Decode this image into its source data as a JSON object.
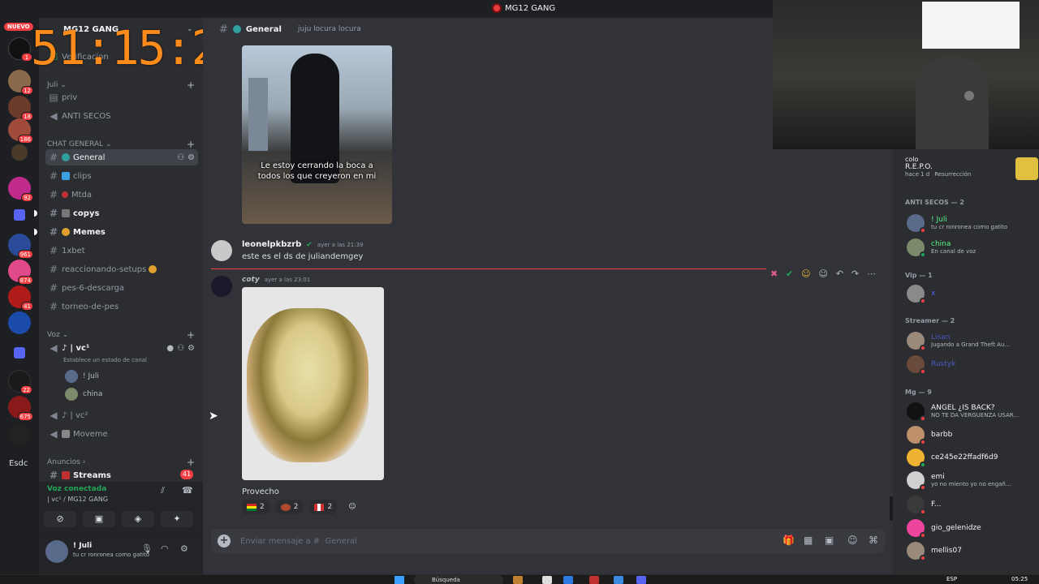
{
  "window": {
    "title": "MG12 GANG"
  },
  "rail": {
    "nuevo_label": "NUEVO",
    "badges": [
      "1",
      "12",
      "18",
      "186",
      "92",
      "961",
      "874",
      "41",
      "22",
      "675"
    ],
    "bottom_label": "Esdc"
  },
  "timer": {
    "text": "51:15:23"
  },
  "server": {
    "name": "MG12 GANG",
    "verification_label": "Verificacion"
  },
  "sidebar": {
    "cat_juli": "Juli",
    "ch_priv": "priv",
    "ch_anti": "ANTI SECOS",
    "cat_chat": "CHAT GENERAL",
    "ch_general": "General",
    "ch_clips": "clips",
    "ch_mtda": "Mtda",
    "ch_copys": "copys",
    "ch_memes": "Memes",
    "ch_1xbet": "1xbet",
    "ch_reaccionando": "reaccionando-setups",
    "ch_pes": "pes-6-descarga",
    "ch_torneo": "torneo-de-pes",
    "cat_voz": "Voz",
    "vc1": "| vc¹",
    "vc1_status": "Establece un estado de canal",
    "vc1_member1": "! Juli",
    "vc1_member2": "china",
    "vc2": "| vc²",
    "moveme": "Moveme",
    "cat_anuncios": "Anuncios",
    "ch_streams": "Streams",
    "streams_count": "41"
  },
  "voice": {
    "connected": "Voz conectada",
    "where": "| vc¹ / MG12 GANG"
  },
  "user": {
    "name": "! Juli",
    "status": "tu cr ronronea como gatito"
  },
  "chat": {
    "channel_name": "General",
    "topic": "juju locura locura",
    "image1_caption": "Le estoy cerrando la boca a todos los que creyeron en mi",
    "msg1_author": "leonelpkbzrb",
    "msg1_time": "ayer a las 21:39",
    "msg1_text": "este es el ds de juliandemgey",
    "msg2_author": "coty",
    "msg2_time": "ayer a las 23:01",
    "msg2_text": "Provecho",
    "reactions": [
      {
        "count": "2",
        "color": "#2e8b3a"
      },
      {
        "count": "2",
        "color": "#b04a2a"
      },
      {
        "count": "2",
        "color": "#d22f2f"
      }
    ],
    "composer_placeholder": "Enviar mensaje a #  General"
  },
  "members": {
    "activity_name": "colo",
    "activity_game": "R.E.P.O.",
    "activity_time": "hace 1 d",
    "activity_extra": "Resurrección",
    "groups": {
      "anti": "ANTI SECOS — 2",
      "vip": "Vip — 1",
      "streamer": "Streamer — 2",
      "mg": "Mg — 9"
    },
    "anti_1_name": "! Juli",
    "anti_1_sub": "tu cr ronronea como gatito",
    "anti_2_name": "china",
    "anti_2_sub": "En canal de voz",
    "vip_1_name": "x",
    "streamer_1_name": "Lisan",
    "streamer_1_sub": "Jugando a Grand Theft Au...",
    "streamer_2_name": "Rustyk",
    "mg_1_name": "ANGEL ¿IS BACK?",
    "mg_1_sub": "NO TE DA VERGUENZA USAR...",
    "mg_2_name": "barbb",
    "mg_3_name": "ce245e22ffadf6d9",
    "mg_4_name": "emi",
    "mg_4_sub": "yo no miento yo no engañ...",
    "mg_5_name": "F...",
    "mg_6_name": "gio_gelenidze",
    "mg_7_name": "mellis07"
  },
  "taskbar": {
    "search": "Búsqueda",
    "lang": "ESP",
    "clock": "05:25"
  }
}
